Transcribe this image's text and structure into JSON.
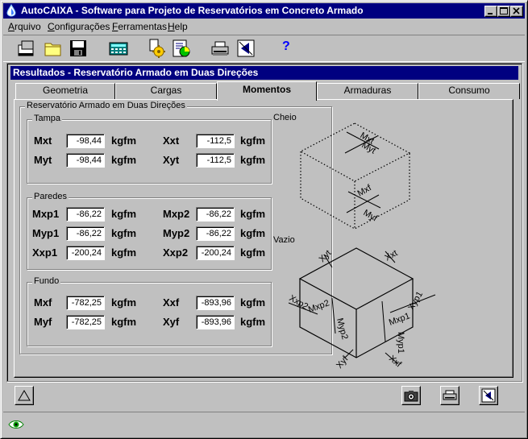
{
  "window": {
    "title": "AutoCAIXA - Software para Projeto de Reservatórios em Concreto Armado"
  },
  "menu": [
    {
      "label": "Arquivo",
      "accel": "A"
    },
    {
      "label": "Configurações",
      "accel": "C"
    },
    {
      "label": "Ferramentas",
      "accel": "F"
    },
    {
      "label": "Help",
      "accel": "H"
    }
  ],
  "toolbar": {
    "icons": [
      "new-icon",
      "open-folder-icon",
      "save-icon",
      "calculator-icon",
      "settings-icon",
      "view-icon",
      "printer-icon",
      "export-icon",
      "help-icon"
    ],
    "help_glyph": "?"
  },
  "child": {
    "title": "Resultados - Reservatório Armado em Duas Direções"
  },
  "tabs": [
    {
      "label": "Geometria"
    },
    {
      "label": "Cargas"
    },
    {
      "label": "Momentos"
    },
    {
      "label": "Armaduras"
    },
    {
      "label": "Consumo"
    }
  ],
  "group": {
    "title": "Reservatório Armado em Duas Direções"
  },
  "tampa": {
    "title": "Tampa",
    "rows": [
      {
        "l1": "Mxt",
        "v1": "-98,44",
        "l2": "Xxt",
        "v2": "-112,5"
      },
      {
        "l1": "Myt",
        "v1": "-98,44",
        "l2": "Xyt",
        "v2": "-112,5"
      }
    ]
  },
  "paredes": {
    "title": "Paredes",
    "rows": [
      {
        "l1": "Mxp1",
        "v1": "-86,22",
        "l2": "Mxp2",
        "v2": "-86,22"
      },
      {
        "l1": "Myp1",
        "v1": "-86,22",
        "l2": "Myp2",
        "v2": "-86,22"
      },
      {
        "l1": "Xxp1",
        "v1": "-200,24",
        "l2": "Xxp2",
        "v2": "-200,24"
      }
    ]
  },
  "fundo": {
    "title": "Fundo",
    "rows": [
      {
        "l1": "Mxf",
        "v1": "-782,25",
        "l2": "Xxf",
        "v2": "-893,96"
      },
      {
        "l1": "Myf",
        "v1": "-782,25",
        "l2": "Xyf",
        "v2": "-893,96"
      }
    ]
  },
  "unit": "kgfm",
  "diagram": {
    "cheio_label": "Cheio",
    "vazio_label": "Vazio",
    "cheio_marks": {
      "mxt": "Mxt",
      "myt": "Myt",
      "mxf": "Mxf",
      "myf": "Myf"
    },
    "vazio_marks": {
      "xyt": "Xyt",
      "xxt": "Xxt",
      "xxp2": "Xxp2",
      "mxp2": "Mxp2",
      "myp2": "Myp2",
      "mxp1": "Mxp1",
      "xyp1": "Xyp1",
      "myp1": "Myp1",
      "xyf": "Xyf",
      "xxf": "Xxf"
    }
  },
  "bottom_buttons": [
    "triangle-icon",
    "camera-icon",
    "printer-icon",
    "export-icon"
  ],
  "status": {
    "icon": "eye-icon"
  },
  "colors": {
    "title_bar": "#000080",
    "face": "#c0c0c0"
  }
}
